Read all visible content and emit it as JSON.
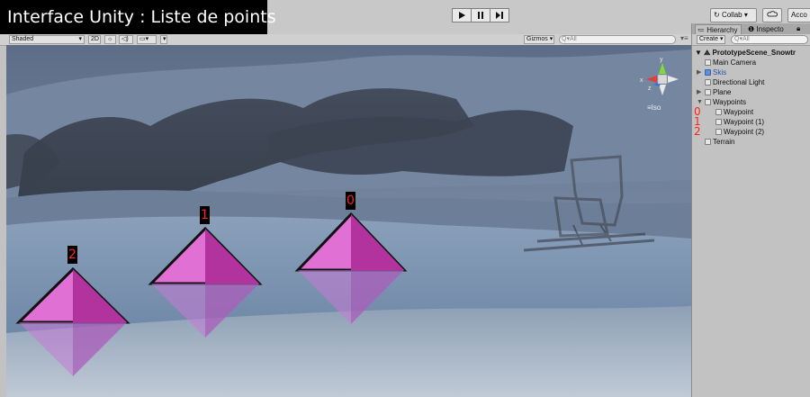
{
  "caption": "Interface Unity : Liste de points",
  "toolbar": {
    "collab_label": "Collab",
    "account_label": "Acco",
    "cloud_icon": "cloud-icon",
    "play_icon": "play-icon",
    "pause_icon": "pause-icon",
    "step_icon": "step-icon"
  },
  "scene_toolbar": {
    "shading_mode": "Shaded",
    "mode_2d": "2D",
    "gizmos_label": "Gizmos",
    "search_placeholder": "Q▾All"
  },
  "scene": {
    "iso_label": "Iso",
    "waypoint_markers": [
      "0",
      "1",
      "2"
    ]
  },
  "hierarchy": {
    "tabs": {
      "hierarchy": "Hierarchy",
      "inspector": "Inspecto"
    },
    "create_label": "Create",
    "search_placeholder": "Q▾All",
    "scene_name": "PrototypeScene_Snowtr",
    "items": [
      {
        "label": "Main Camera",
        "depth": 1,
        "expander": "",
        "icon": "gameobject-icon"
      },
      {
        "label": "Skis",
        "depth": 1,
        "expander": "▶",
        "icon": "prefab-icon"
      },
      {
        "label": "Directional Light",
        "depth": 1,
        "expander": "",
        "icon": "gameobject-icon"
      },
      {
        "label": "Plane",
        "depth": 1,
        "expander": "▶",
        "icon": "gameobject-icon"
      },
      {
        "label": "Waypoints",
        "depth": 1,
        "expander": "▼",
        "icon": "gameobject-icon"
      },
      {
        "label": "Waypoint",
        "depth": 2,
        "expander": "",
        "icon": "gameobject-icon",
        "annotation": "0"
      },
      {
        "label": "Waypoint (1)",
        "depth": 2,
        "expander": "",
        "icon": "gameobject-icon",
        "annotation": "1"
      },
      {
        "label": "Waypoint (2)",
        "depth": 2,
        "expander": "",
        "icon": "gameobject-icon",
        "annotation": "2"
      },
      {
        "label": "Terrain",
        "depth": 1,
        "expander": "",
        "icon": "gameobject-icon"
      }
    ]
  },
  "colors": {
    "marker_magenta": "#d94fc4",
    "annotation_red": "#ff2222",
    "skis_blue": "#2c4fb0"
  }
}
